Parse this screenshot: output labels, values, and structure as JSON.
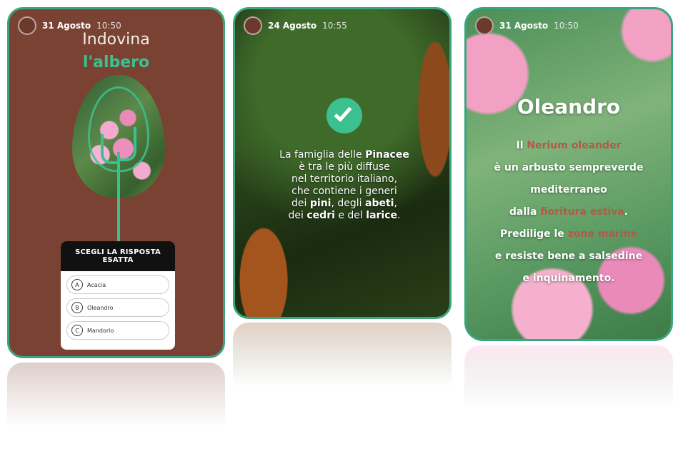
{
  "accent": "#3dc08f",
  "card1": {
    "date": "31 Agosto",
    "time": "10:50",
    "avatar_icon": "brand-avatar-icon",
    "title_line1": "Indovina",
    "title_line2": "l'albero",
    "quiz": {
      "header": "SCEGLI LA RISPOSTA ESATTA",
      "options": [
        {
          "letter": "A",
          "label": "Acacia"
        },
        {
          "letter": "B",
          "label": "Oleandro"
        },
        {
          "letter": "C",
          "label": "Mandorlo"
        }
      ]
    }
  },
  "card2": {
    "date": "24 Agosto",
    "time": "10:55",
    "check_icon": "checkmark-icon",
    "text": {
      "p1": "La famiglia delle ",
      "b1": "Pinacee",
      "p2": "è tra le più diffuse",
      "p3": "nel territorio italiano,",
      "p4": "che contiene i generi",
      "p5": "dei ",
      "b2": "pini",
      "p6": ", degli ",
      "b3": "abeti",
      "p7": ",",
      "p8": "dei ",
      "b4": "cedri",
      "p9": " e del ",
      "b5": "larice",
      "p10": "."
    }
  },
  "card3": {
    "date": "31 Agosto",
    "time": "10:50",
    "title": "Oleandro",
    "lines": {
      "l1a": "Il ",
      "l1b": "Nerium oleander",
      "l2": "è un arbusto sempreverde",
      "l3": "mediterraneo",
      "l4a": "dalla ",
      "l4b": "fioritura estiva",
      "l4c": ".",
      "l5a": "Predilige le ",
      "l5b": "zone marine",
      "l6": "e resiste bene a salsedine",
      "l7": "e inquinamento."
    }
  }
}
